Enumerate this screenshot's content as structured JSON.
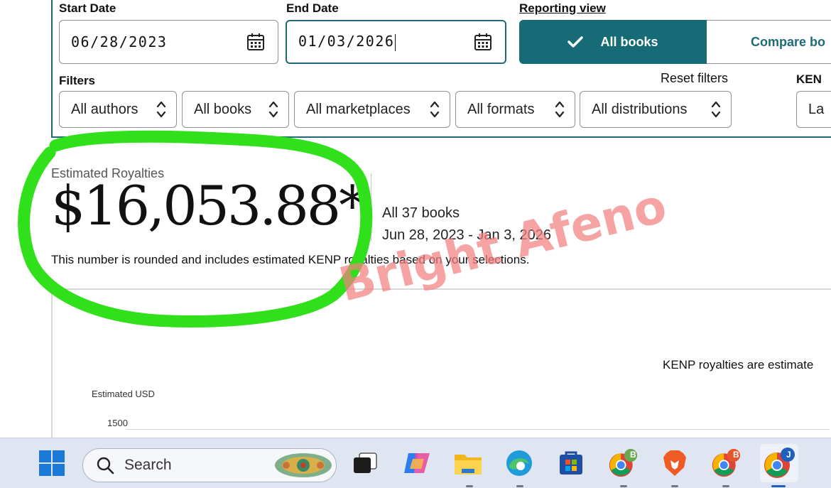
{
  "filters_panel": {
    "start_date_label": "Start Date",
    "start_date_value": "06/28/2023",
    "end_date_label": "End Date",
    "end_date_value": "01/03/2026",
    "reporting_view_label": "Reporting view",
    "reporting_options": [
      "All books",
      "Compare bo"
    ],
    "filters_label": "Filters",
    "reset_filters": "Reset filters",
    "dropdowns": [
      "All authors",
      "All books",
      "All marketplaces",
      "All formats",
      "All distributions"
    ],
    "kenp_label": "KEN",
    "kenp_value": "La"
  },
  "summary": {
    "estimated_royalties_label": "Estimated Royalties",
    "amount": "$16,053.88*",
    "books_count": "All 37 books",
    "date_range": "Jun 28, 2023 - Jan 3, 2026",
    "note": "This number is rounded and includes estimated KENP royalties based on your selections."
  },
  "chart_area": {
    "kenp_note": "KENP royalties are estimate",
    "y_axis_title": "Estimated USD",
    "y_tick": "1500"
  },
  "watermark": "Bright Afeno",
  "taskbar": {
    "search_placeholder": "Search",
    "badges": {
      "chrome_b": "B",
      "chrome_b2": "B",
      "chrome_j": "J"
    }
  },
  "colors": {
    "teal": "#166b77",
    "highlight_green": "#2fe01a",
    "watermark": "#f28080"
  }
}
